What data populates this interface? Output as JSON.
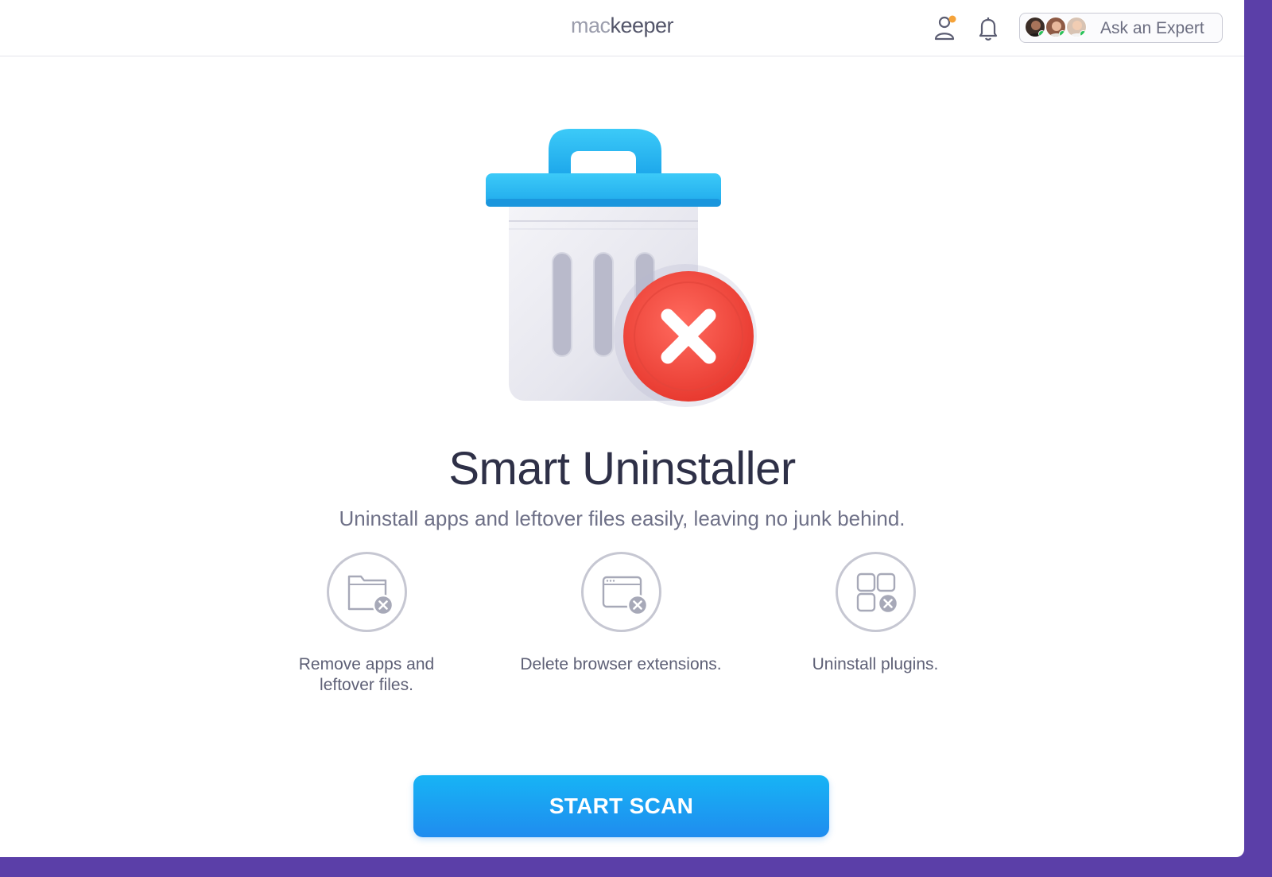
{
  "header": {
    "logo_prefix": "mac",
    "logo_suffix": "keeper",
    "ask_expert_label": "Ask an Expert",
    "expert_avatars": [
      "expert-avatar-1",
      "expert-avatar-2",
      "expert-avatar-3"
    ]
  },
  "icons": {
    "account": "user-icon",
    "notifications": "bell-icon",
    "hero": "trash-icon",
    "hero_badge": "close-icon",
    "feature_1": "folder-remove-icon",
    "feature_2": "browser-remove-icon",
    "feature_3": "apps-remove-icon"
  },
  "main": {
    "title": "Smart Uninstaller",
    "subtitle": "Uninstall apps and leftover files easily, leaving no junk behind.",
    "features": [
      {
        "label_line1": "Remove apps and",
        "label_line2": "leftover files."
      },
      {
        "label_line1": "Delete browser extensions.",
        "label_line2": ""
      },
      {
        "label_line1": "Uninstall plugins.",
        "label_line2": ""
      }
    ],
    "start_button": "START SCAN"
  },
  "colors": {
    "accent": "#1fa0f2",
    "danger": "#f0463b",
    "notification_dot": "#f5a33a",
    "online": "#2bc25b"
  }
}
